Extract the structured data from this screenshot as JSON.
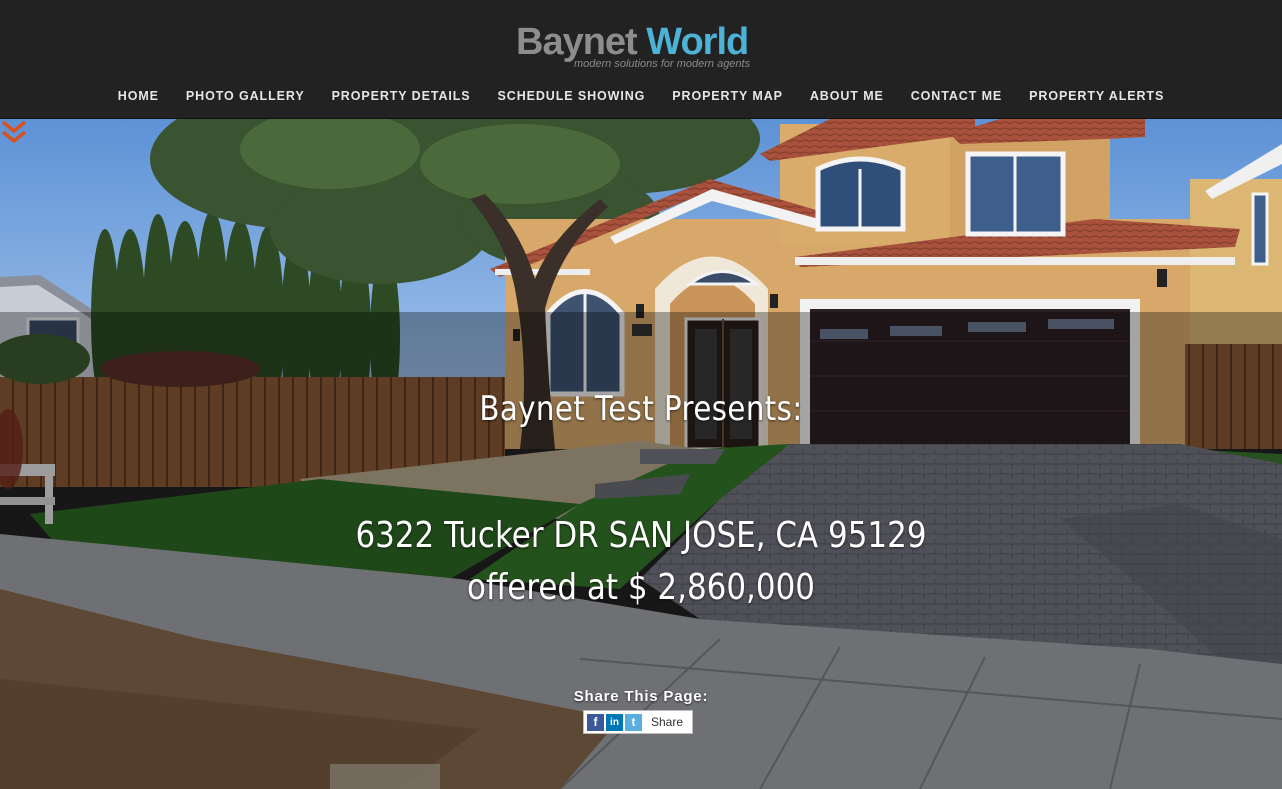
{
  "brand": {
    "logo_part1": "Baynet ",
    "logo_part2": "World",
    "tagline": "modern solutions for modern agents",
    "accent_color": "#4cb3d6"
  },
  "nav": [
    {
      "label": "HOME"
    },
    {
      "label": "PHOTO GALLERY"
    },
    {
      "label": "PROPERTY DETAILS"
    },
    {
      "label": "SCHEDULE SHOWING"
    },
    {
      "label": "PROPERTY MAP"
    },
    {
      "label": "ABOUT ME"
    },
    {
      "label": "CONTACT ME"
    },
    {
      "label": "PROPERTY ALERTS"
    }
  ],
  "hero": {
    "presents": "Baynet Test Presents:",
    "address": "6322 Tucker DR SAN JOSE, CA 95129",
    "price": "offered at $ 2,860,000",
    "image": "house-exterior-photo"
  },
  "share": {
    "label": "Share This Page:",
    "button_label": "Share",
    "icons": [
      "facebook-icon",
      "linkedin-icon",
      "twitter-icon"
    ]
  },
  "scroll_indicator": {
    "icon": "double-chevron-down-icon",
    "color": "#d9501f"
  }
}
